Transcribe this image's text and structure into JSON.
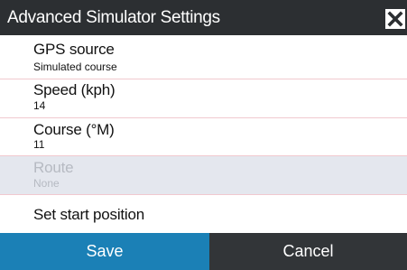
{
  "dialog": {
    "title": "Advanced Simulator Settings"
  },
  "settings": {
    "gps_source": {
      "label": "GPS source",
      "value": "Simulated course"
    },
    "speed": {
      "label": "Speed (kph)",
      "value": "14"
    },
    "course": {
      "label": "Course (°M)",
      "value": "11"
    },
    "route": {
      "label": "Route",
      "value": "None",
      "disabled": true
    },
    "start_position": {
      "label": "Set start position"
    }
  },
  "buttons": {
    "save": "Save",
    "cancel": "Cancel"
  },
  "colors": {
    "titlebar": "#2c2f32",
    "save_button": "#1b80b6",
    "cancel_button": "#323538",
    "disabled_row": "#e4e7ee",
    "divider": "#f1c9cf"
  },
  "icons": {
    "close": "close-icon"
  }
}
